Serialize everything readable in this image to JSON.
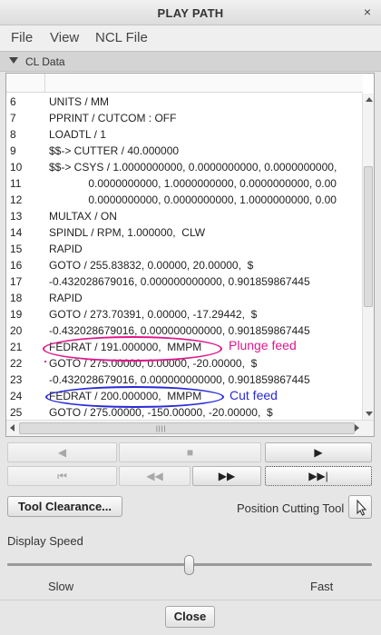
{
  "window": {
    "title": "PLAY PATH",
    "close_glyph": "×"
  },
  "menu": [
    "File",
    "View",
    "NCL File"
  ],
  "section": {
    "label": "CL Data"
  },
  "cl_rows": [
    {
      "num": "6",
      "text": "UNITS / MM"
    },
    {
      "num": "7",
      "text": "PPRINT / CUTCOM : OFF"
    },
    {
      "num": "8",
      "text": "LOADTL / 1"
    },
    {
      "num": "9",
      "text": "$$-> CUTTER / 40.000000"
    },
    {
      "num": "10",
      "text": "$$-> CSYS / 1.0000000000, 0.0000000000, 0.0000000000,"
    },
    {
      "num": "11",
      "text": "             0.0000000000, 1.0000000000, 0.0000000000, 0.00"
    },
    {
      "num": "12",
      "text": "             0.0000000000, 0.0000000000, 1.0000000000, 0.00"
    },
    {
      "num": "13",
      "text": "MULTAX / ON"
    },
    {
      "num": "14",
      "text": "SPINDL / RPM, 1.000000,  CLW"
    },
    {
      "num": "15",
      "text": "RAPID"
    },
    {
      "num": "16",
      "text": "GOTO / 255.83832, 0.00000, 20.00000,  $"
    },
    {
      "num": "17",
      "text": "-0.432028679016, 0.000000000000, 0.901859867445"
    },
    {
      "num": "18",
      "text": "RAPID"
    },
    {
      "num": "19",
      "text": "GOTO / 273.70391, 0.00000, -17.29442,  $"
    },
    {
      "num": "20",
      "text": "-0.432028679016, 0.000000000000, 0.901859867445"
    },
    {
      "num": "21",
      "text": "FEDRAT / 191.000000,  MMPM"
    },
    {
      "num": "22",
      "text": "GOTO / 275.00000, 0.00000, -20.00000,  $"
    },
    {
      "num": "23",
      "text": "-0.432028679016, 0.000000000000, 0.901859867445"
    },
    {
      "num": "24",
      "text": "FEDRAT / 200.000000,  MMPM"
    },
    {
      "num": "25",
      "text": "GOTO / 275.00000, -150.00000, -20.00000,  $"
    }
  ],
  "annotations": {
    "plunge": {
      "text": "Plunge feed",
      "color": "#e0188c"
    },
    "cut": {
      "text": "Cut feed",
      "color": "#2a2ad8"
    }
  },
  "scrollbar": {
    "grip": "||||"
  },
  "transport": {
    "row1": [
      {
        "icon": "step-back-icon",
        "glyph": "◀"
      },
      {
        "icon": "stop-icon",
        "glyph": "■"
      },
      {
        "icon": "play-icon",
        "glyph": "▶"
      }
    ],
    "row2": [
      {
        "icon": "rewind-to-start-icon",
        "glyph": "⏮"
      },
      {
        "icon": "rewind-icon",
        "glyph": "◀◀"
      },
      {
        "icon": "fast-forward-icon",
        "glyph": "▶▶"
      },
      {
        "icon": "forward-to-end-icon",
        "glyph": "▶▶|"
      }
    ]
  },
  "tool_clearance": "Tool Clearance...",
  "position_cutting_tool": "Position Cutting Tool",
  "display_speed": {
    "label": "Display Speed",
    "slow": "Slow",
    "fast": "Fast",
    "level": 0.5
  },
  "close": "Close"
}
